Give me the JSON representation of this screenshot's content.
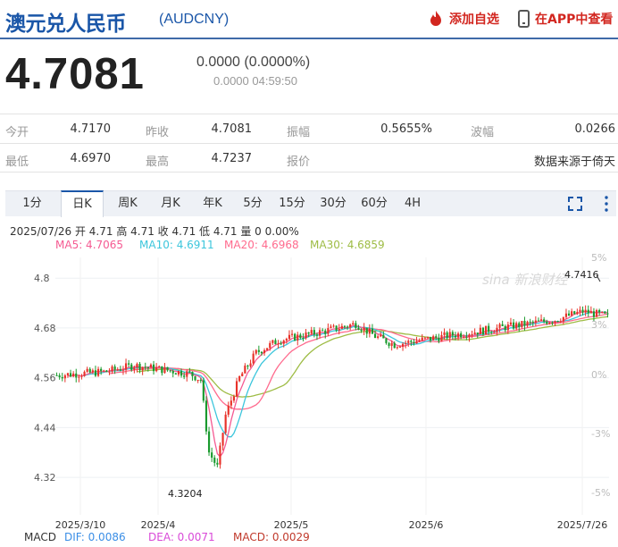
{
  "header": {
    "title": "澳元兑人民币",
    "code": "(AUDCNY)",
    "add_label": "添加自选",
    "app_label": "在APP中查看",
    "accent": "#1a56a8",
    "action_color": "#d2261f"
  },
  "quote": {
    "price": "4.7081",
    "change": "0.0000 (0.0000%)",
    "time": "0.0000 04:59:50"
  },
  "stats": {
    "row1": [
      {
        "label": "今开",
        "value": "4.7170"
      },
      {
        "label": "昨收",
        "value": "4.7081"
      },
      {
        "label": "振幅",
        "value": "0.5655%"
      },
      {
        "label": "波幅",
        "value": "0.0266"
      }
    ],
    "row2": [
      {
        "label": "最低",
        "value": "4.6970"
      },
      {
        "label": "最高",
        "value": "4.7237"
      },
      {
        "label": "报价",
        "value": ""
      },
      {
        "label": "",
        "value": "数据来源于倚天"
      }
    ]
  },
  "tabs": [
    "1分",
    "日K",
    "周K",
    "月K",
    "年K",
    "5分",
    "15分",
    "30分",
    "60分",
    "4H"
  ],
  "active_tab": "日K",
  "candle_info": "2025/07/26 开 4.71 高 4.71 收 4.71 低 4.71 量 0 0.00%",
  "ma": {
    "ma5": "MA5: 4.7065",
    "ma10": "MA10: 4.6911",
    "ma20": "MA20: 4.6968",
    "ma30": "MA30: 4.6859"
  },
  "watermark": "sina 新浪财经",
  "macd": {
    "label": "MACD",
    "dif": "DIF: 0.0086",
    "dea": "DEA: 0.0071",
    "macd": "MACD: 0.0029"
  },
  "chart_data": {
    "type": "candlestick",
    "y_ticks": [
      "4.8",
      "4.68",
      "4.56",
      "4.44",
      "4.32"
    ],
    "y_tick_values": [
      4.8,
      4.68,
      4.56,
      4.44,
      4.32
    ],
    "pct_ticks": [
      "5%",
      "3%",
      "0%",
      "-3%",
      "-5%"
    ],
    "x_ticks": [
      "2025/3/10",
      "2025/4",
      "2025/5",
      "2025/6",
      "2025/7/26"
    ],
    "ylim": [
      4.29,
      4.85
    ],
    "high_label": "4.7416",
    "low_label": "4.3204",
    "colors": {
      "up": "#e8322a",
      "down": "#1a9a2e",
      "ma5": "#f55a92",
      "ma10": "#3cc6dc",
      "ma20": "#ff6b8e",
      "ma30": "#9ebc45"
    }
  }
}
